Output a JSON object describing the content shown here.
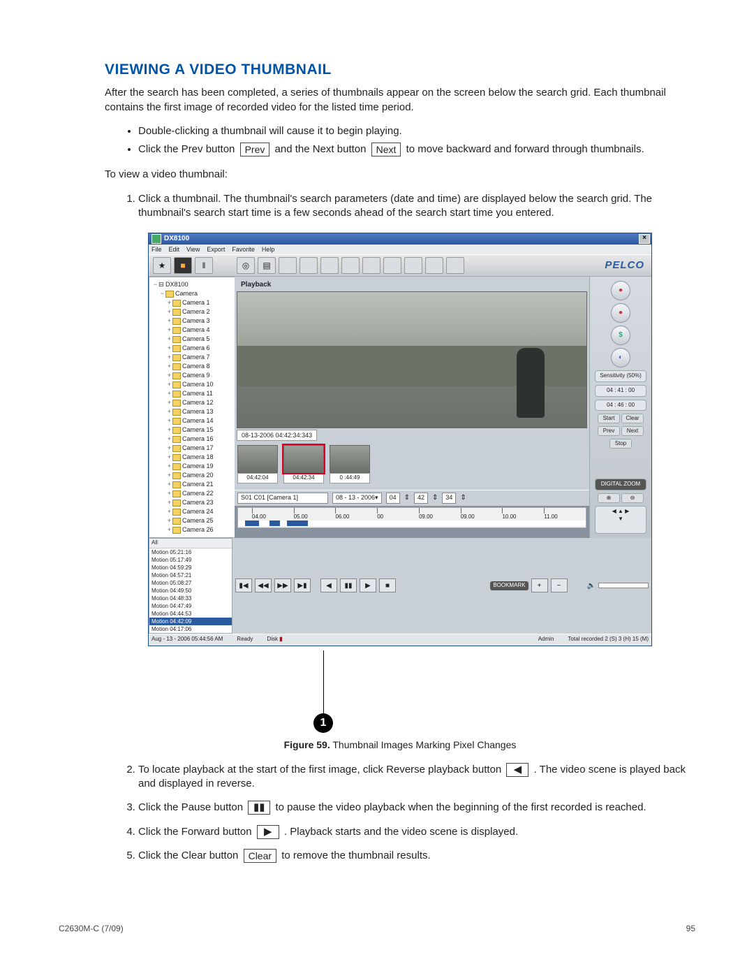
{
  "heading": "VIEWING A VIDEO THUMBNAIL",
  "intro": "After the search has been completed, a series of thumbnails appear on the screen below the search grid. Each thumbnail contains the first image of recorded video for the listed time period.",
  "bullets": {
    "b1": "Double-clicking a thumbnail will cause it to begin playing.",
    "b2a": "Click the Prev button ",
    "b2_prev": "Prev",
    "b2b": " and the Next button ",
    "b2_next": "Next",
    "b2c": " to move backward and forward through thumbnails."
  },
  "lead": "To view a video thumbnail:",
  "steps": {
    "s1": "Click a thumbnail. The thumbnail's search parameters (date and time) are displayed below the search grid. The thumbnail's search start time is a few seconds ahead of the search start time you entered.",
    "s2a": "To locate playback at the start of the first image, click Reverse playback button ",
    "s2_icon": "◀",
    "s2b": " . The video scene is played back and displayed in reverse.",
    "s3a": "Click the Pause button ",
    "s3_icon": "▮▮",
    "s3b": " to pause the video playback when the beginning of the first recorded is reached.",
    "s4a": "Click the Forward button ",
    "s4_icon": "▶",
    "s4b": " . Playback starts and the video scene is displayed.",
    "s5a": "Click the Clear button ",
    "s5_btn": "Clear",
    "s5b": " to remove the thumbnail results."
  },
  "figure": {
    "callout_num": "1",
    "label_bold": "Figure 59.",
    "label_rest": "  Thumbnail Images Marking Pixel Changes"
  },
  "footer": {
    "left": "C2630M-C (7/09)",
    "right": "95"
  },
  "screenshot": {
    "title": "DX8100",
    "menus": [
      "File",
      "Edit",
      "View",
      "Export",
      "Favorite",
      "Help"
    ],
    "toolbar_icons": [
      "person-icon",
      "camera-icon",
      "tools-icon",
      "cd-icon",
      "printer-icon",
      "g1",
      "g2",
      "g3",
      "g4",
      "g5",
      "g6",
      "g7",
      "g8",
      "g9"
    ],
    "brand": "PELCO",
    "tree_root": "DX8100",
    "tree_group": "Camera",
    "cameras": [
      "Camera 1",
      "Camera 2",
      "Camera 3",
      "Camera 4",
      "Camera 5",
      "Camera 6",
      "Camera 7",
      "Camera 8",
      "Camera 9",
      "Camera 10",
      "Camera 11",
      "Camera 12",
      "Camera 13",
      "Camera 14",
      "Camera 15",
      "Camera 16",
      "Camera 17",
      "Camera 18",
      "Camera 19",
      "Camera 20",
      "Camera 21",
      "Camera 22",
      "Camera 23",
      "Camera 24",
      "Camera 25",
      "Camera 26"
    ],
    "playback_label": "Playback",
    "playback_timestamp": "08-13-2006 04:42:34:343",
    "thumbs": [
      "04:42:04",
      "04:42:34",
      "0  :44:49"
    ],
    "thumb_selected": 1,
    "ctrl_cam": "S01 C01 [Camera 1]",
    "ctrl_date": "08 - 13 - 2006",
    "ctrl_time_h": "04",
    "ctrl_time_m": "42",
    "ctrl_time_s": "34",
    "ruler_ticks": [
      "04.00",
      "05.00",
      "06.00",
      "00",
      "09.00",
      "09.00",
      "10.00",
      "11.00"
    ],
    "events_header": "All",
    "events": [
      "Motion 05:21:16",
      "Motion 05:17:49",
      "Motion 04:59:29",
      "Motion 04:57:21",
      "Motion 05:08:27",
      "Motion 04:49:50",
      "Motion 04:48:33",
      "Motion 04:47:49",
      "Motion 04:44:53",
      "Motion 04:42:09",
      "Motion 04:17:06"
    ],
    "event_hl": 9,
    "right_buttons": [
      "rec",
      "rec",
      "cash",
      "globe"
    ],
    "sensitivity": "Sensitivity (50%)",
    "time_start": "04 : 41 : 00",
    "time_end": "04 : 46 : 00",
    "mini_buttons": [
      "Start",
      "Clear",
      "Prev",
      "Next",
      "Stop"
    ],
    "zoom_label": "DIGITAL ZOOM",
    "bookmark_label": "BOOKMARK",
    "status_date": "Aug - 13 - 2006  05:44:56 AM",
    "status_ready": "Ready",
    "status_disk": "Disk",
    "status_admin": "Admin",
    "status_rec": "Total recorded 2 (S) 3 (H) 15 (M)"
  }
}
